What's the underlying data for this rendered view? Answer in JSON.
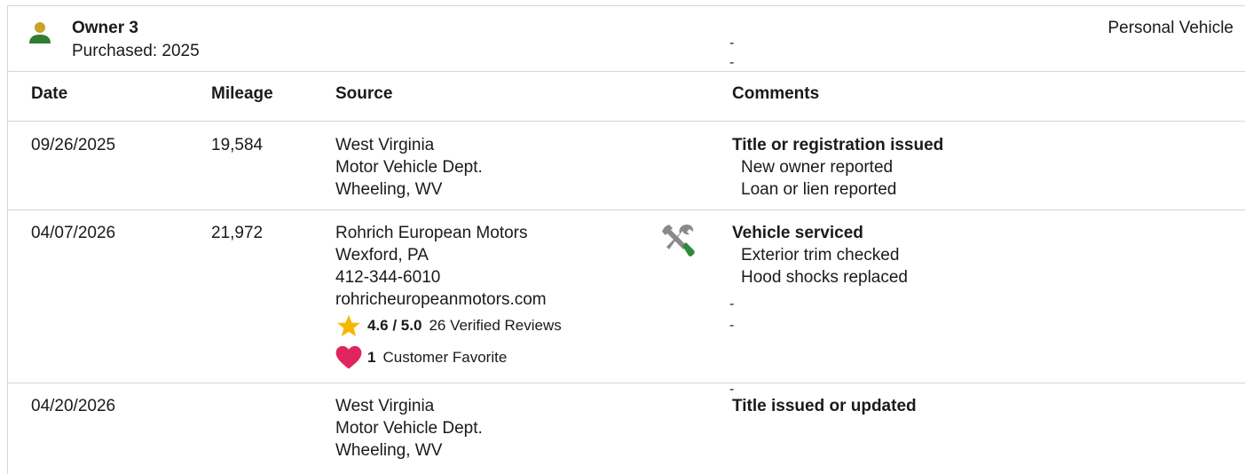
{
  "owner": {
    "name": "Owner 3",
    "purchased": "Purchased: 2025",
    "vehicle_type": "Personal Vehicle",
    "icon": "person-icon",
    "icon_color": "#2e7d32",
    "head_color": "#c9a227"
  },
  "columns": {
    "date": "Date",
    "mileage": "Mileage",
    "source": "Source",
    "comments": "Comments"
  },
  "rows": [
    {
      "date": "09/26/2025",
      "mileage": "19,584",
      "source": [
        "West Virginia",
        "Motor Vehicle Dept.",
        "Wheeling, WV"
      ],
      "comment_title": "Title or registration issued",
      "comment_items": [
        "New owner reported",
        "Loan or lien reported"
      ]
    },
    {
      "date": "04/07/2026",
      "mileage": "21,972",
      "source": [
        "Rohrich European Motors",
        "Wexford, PA",
        "412-344-6010",
        "rohricheuropeanmotors.com"
      ],
      "rating": "4.6 / 5.0",
      "reviews": "26 Verified Reviews",
      "favorites_count": "1",
      "favorites_label": "Customer Favorite",
      "icon": "wrench-screwdriver-icon",
      "comment_title": "Vehicle serviced",
      "comment_items": [
        "Exterior trim checked",
        "Hood shocks replaced"
      ]
    },
    {
      "date": "04/20/2026",
      "mileage": "",
      "source": [
        "West Virginia",
        "Motor Vehicle Dept.",
        "Wheeling, WV"
      ],
      "comment_title": "Title issued or updated",
      "comment_items": []
    }
  ],
  "dash": "-",
  "colors": {
    "star": "#f5b800",
    "heart": "#e0245e",
    "border": "#d6d6d6",
    "tool_gray": "#8a8a8a",
    "tool_green": "#2e8b3a"
  }
}
